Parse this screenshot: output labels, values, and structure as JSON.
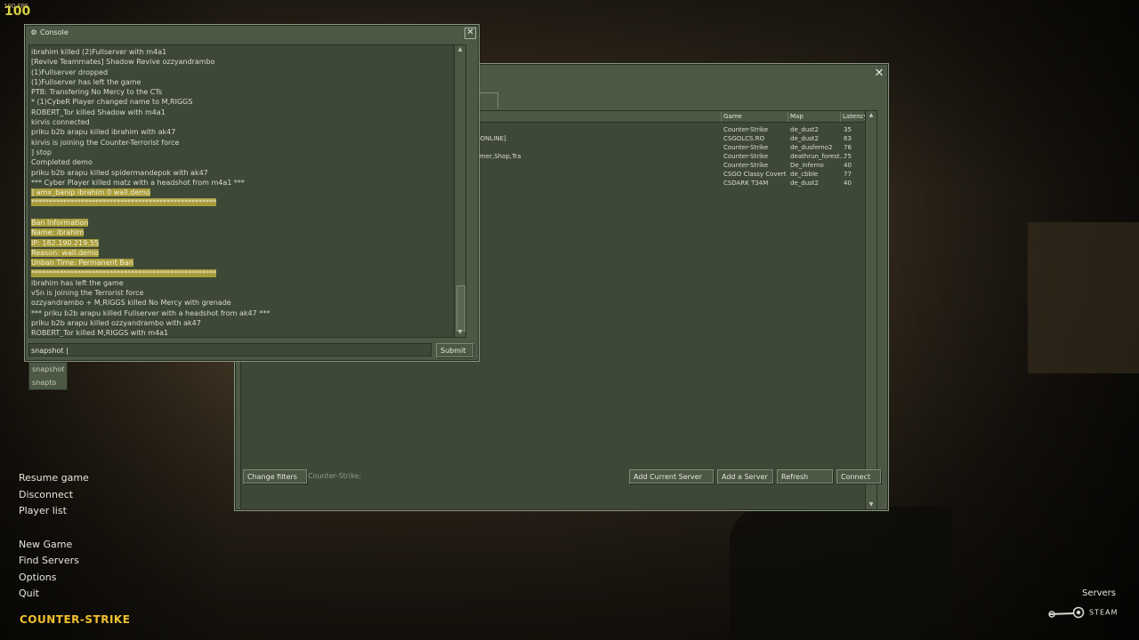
{
  "hud": {
    "fps_small": "100 FPS",
    "fps_big": "100"
  },
  "server_browser": {
    "tab_label": "s",
    "columns": {
      "game": "Game",
      "map": "Map",
      "latency": "Latency"
    },
    "rows": [
      {
        "name": "",
        "game": "Counter-Strike",
        "map": "de_dust2",
        "latency": "35"
      },
      {
        "name": "S ONLINE]",
        "game": "CSGOLCS.RO",
        "map": "de_dust2",
        "latency": "63"
      },
      {
        "name": "",
        "game": "Counter-Strike",
        "map": "de_dusferno2",
        "latency": "76"
      },
      {
        "name": "Timer,Shop,Tra",
        "game": "Counter-Strike",
        "map": "deathrun_forest...",
        "latency": "75"
      },
      {
        "name": "",
        "game": "Counter-Strike",
        "map": "De_inferno",
        "latency": "40"
      },
      {
        "name": "",
        "game": "CSGO Classy Covert",
        "map": "de_cbble",
        "latency": "77"
      },
      {
        "name": "",
        "game": "CSDARK T34M",
        "map": "de_dust2",
        "latency": "40"
      }
    ],
    "buttons": {
      "change_filters": "Change filters",
      "add_current_server": "Add Current Server",
      "add_server": "Add a Server",
      "refresh": "Refresh",
      "connect": "Connect"
    },
    "filter_text": "Counter-Strike;"
  },
  "console": {
    "title": "Console",
    "lines": [
      {
        "text": "ibrahim killed (2)Fullserver with m4a1",
        "hl": false
      },
      {
        "text": "[Revive Teammates] Shadow Revive ozzyandrambo",
        "hl": false
      },
      {
        "text": "(1)Fullserver dropped",
        "hl": false
      },
      {
        "text": "(1)Fullserver has left the game",
        "hl": false
      },
      {
        "text": "PTB: Transfering No Mercy to the CTs",
        "hl": false
      },
      {
        "text": "* (1)CybeR Player changed name to M,RIGGS",
        "hl": false
      },
      {
        "text": "ROBERT_Tor killed Shadow with m4a1",
        "hl": false
      },
      {
        "text": "kirvis connected",
        "hl": false
      },
      {
        "text": "priku b2b arapu killed ibrahim with ak47",
        "hl": false
      },
      {
        "text": "kirvis is joining the Counter-Terrorist force",
        "hl": false
      },
      {
        "text": "] stop",
        "hl": false
      },
      {
        "text": "Completed demo",
        "hl": false
      },
      {
        "text": "priku b2b arapu killed spidermandepok with ak47",
        "hl": false
      },
      {
        "text": "*** Cyber Player killed matz with a headshot from m4a1 ***",
        "hl": false
      },
      {
        "text": "] amx_banip ibrahim 0 wall.demo",
        "hl": true
      },
      {
        "text": "****************************************************",
        "hl": true
      },
      {
        "text": "",
        "hl": false
      },
      {
        "text": "Ban Information",
        "hl": true
      },
      {
        "text": "Name: ibrahim",
        "hl": true
      },
      {
        "text": "IP: 182.190.219.55",
        "hl": true
      },
      {
        "text": "Reason: wall.demo",
        "hl": true
      },
      {
        "text": "Unban Time: Permanent Ban",
        "hl": true
      },
      {
        "text": "****************************************************",
        "hl": true
      },
      {
        "text": "ibrahim has left the game",
        "hl": false
      },
      {
        "text": "vSn is joining the Terrorist force",
        "hl": false
      },
      {
        "text": "ozzyandrambo + M,RIGGS killed No Mercy with grenade",
        "hl": false
      },
      {
        "text": "*** priku b2b arapu killed Fullserver with a headshot from ak47 ***",
        "hl": false
      },
      {
        "text": "priku b2b arapu killed ozzyandrambo with ak47",
        "hl": false
      },
      {
        "text": "ROBERT_Tor killed M,RIGGS with m4a1",
        "hl": false
      }
    ],
    "input_value": "snapshot |",
    "submit_label": "Submit",
    "autocomplete": [
      "snapshot",
      "snapto"
    ]
  },
  "main_menu": {
    "items": [
      "Resume game",
      "Disconnect",
      "Player list",
      "New Game",
      "Find Servers",
      "Options",
      "Quit"
    ]
  },
  "branding": {
    "logo": "COUNTER-STRIKE",
    "servers_label": "Servers",
    "steam": "STEAM"
  }
}
